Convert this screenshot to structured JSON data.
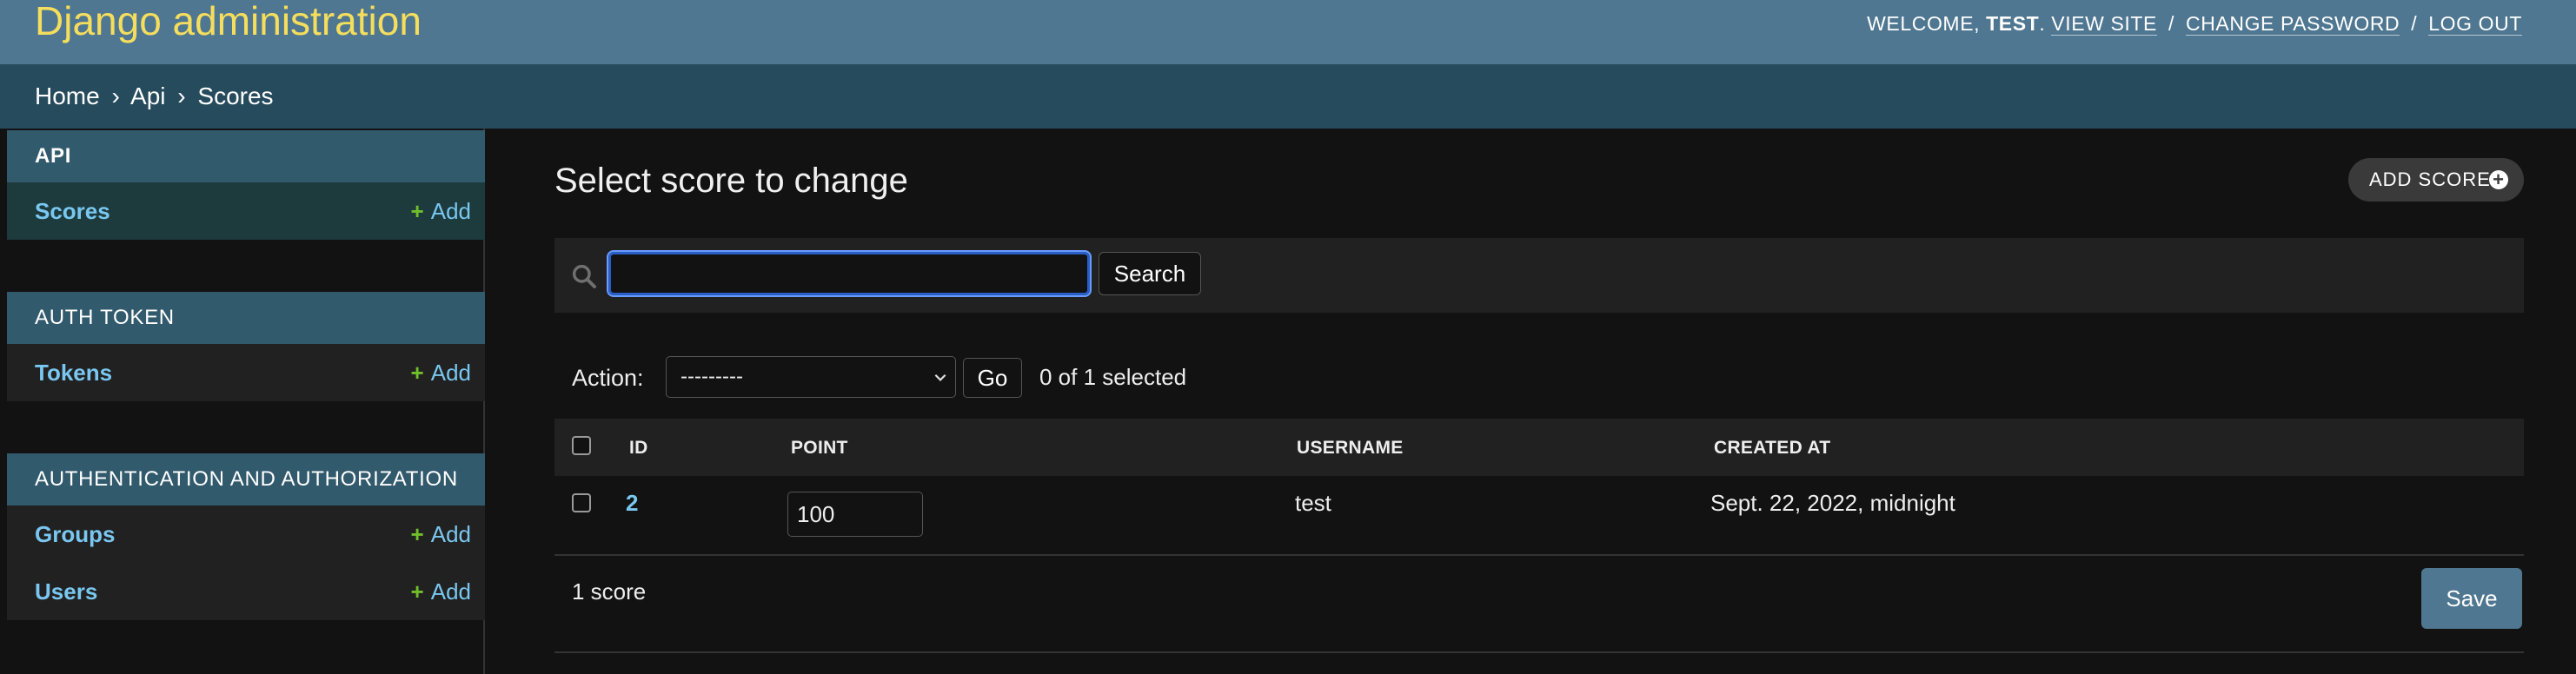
{
  "header": {
    "site_name": "Django administration",
    "welcome": "WELCOME,",
    "username": "TEST",
    "view_site": "VIEW SITE",
    "change_password": "CHANGE PASSWORD",
    "log_out": "LOG OUT",
    "separator": "/"
  },
  "breadcrumbs": {
    "home": "Home",
    "app": "Api",
    "current": "Scores",
    "separator": "›"
  },
  "sidebar": {
    "modules": [
      {
        "caption": "API",
        "models": [
          {
            "label": "Scores",
            "add": "Add",
            "active": true
          }
        ]
      },
      {
        "caption": "AUTH TOKEN",
        "models": [
          {
            "label": "Tokens",
            "add": "Add"
          }
        ]
      },
      {
        "caption": "AUTHENTICATION AND AUTHORIZATION",
        "models": [
          {
            "label": "Groups",
            "add": "Add"
          },
          {
            "label": "Users",
            "add": "Add"
          }
        ]
      }
    ]
  },
  "content": {
    "title": "Select score to change",
    "add_button": "ADD SCORE",
    "search": {
      "value": "",
      "button": "Search",
      "icon": "search-icon"
    },
    "actions": {
      "label": "Action:",
      "selected": "---------",
      "go": "Go",
      "selection_count": "0 of 1 selected"
    },
    "table": {
      "columns": [
        "ID",
        "POINT",
        "USERNAME",
        "CREATED AT"
      ],
      "rows": [
        {
          "id": "2",
          "point": "100",
          "username": "test",
          "created_at": "Sept. 22, 2022, midnight"
        }
      ]
    },
    "result_count": "1 score",
    "save": "Save"
  },
  "colors": {
    "header_bg": "#4f7791",
    "site_name": "#f5dd5d",
    "breadcrumbs_bg": "#264b5d",
    "module_caption_bg": "#325a6d",
    "link": "#79c7f0",
    "add_plus": "#70bf2b"
  }
}
